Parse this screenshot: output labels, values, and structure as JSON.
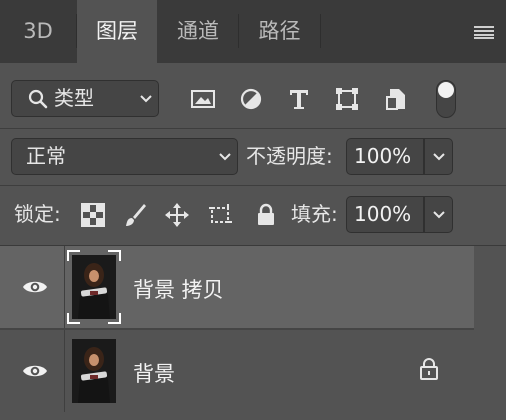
{
  "tabs": [
    "3D",
    "图层",
    "通道",
    "路径"
  ],
  "active_tab": "图层",
  "filter": {
    "label": "类型"
  },
  "blend": {
    "mode": "正常",
    "opacity_label": "不透明度:",
    "opacity_value": "100%"
  },
  "lock": {
    "label": "锁定:",
    "fill_label": "填充:",
    "fill_value": "100%"
  },
  "layers": [
    {
      "name": "背景 拷贝",
      "visible": true,
      "selected": true,
      "locked": false
    },
    {
      "name": "背景",
      "visible": true,
      "selected": false,
      "locked": true
    }
  ],
  "colors": {
    "panel": "#535353",
    "tabbar": "#3a3a3a",
    "selected_row": "#646464"
  }
}
